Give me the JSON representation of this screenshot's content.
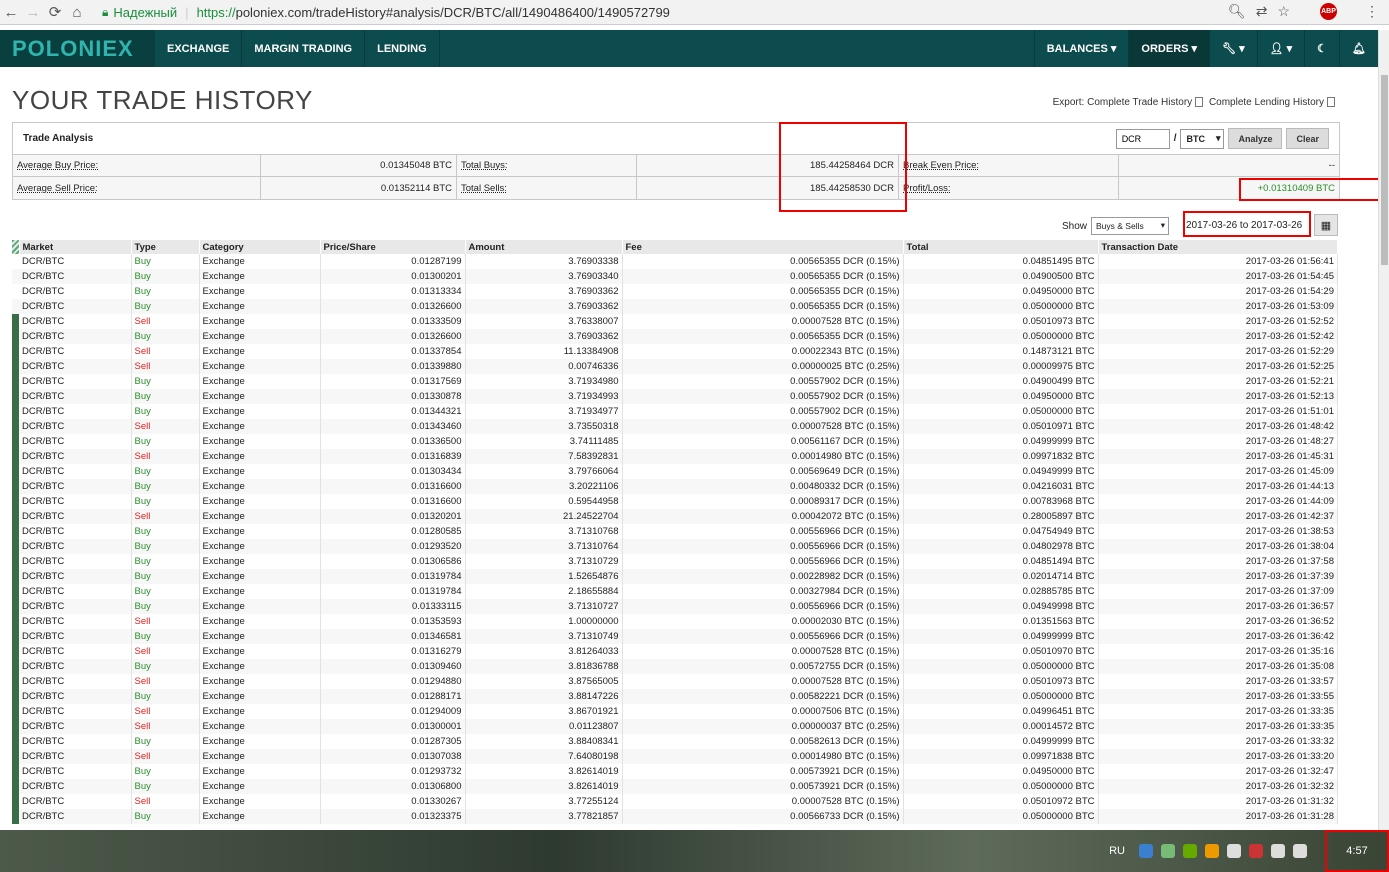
{
  "browser": {
    "secure_label": "Надежный",
    "url_scheme": "https://",
    "url_rest": "poloniex.com/tradeHistory#analysis/DCR/BTC/all/1490486400/1490572799",
    "abp": "ABP"
  },
  "nav": {
    "logo": "POLONIEX",
    "left": [
      "EXCHANGE",
      "MARGIN TRADING",
      "LENDING"
    ],
    "balances": "BALANCES ▾",
    "orders": "ORDERS ▾"
  },
  "page": {
    "title": "YOUR TRADE HISTORY",
    "export_prefix": "Export:",
    "export_trade": "Complete Trade History",
    "export_lending": "Complete Lending History"
  },
  "analysis": {
    "heading": "Trade Analysis",
    "coin_input": "DCR",
    "slash": "/",
    "base_select": "BTC",
    "analyze": "Analyze",
    "clear": "Clear",
    "avg_buy_label": "Average Buy Price:",
    "avg_buy": "0.01345048 BTC",
    "total_buys_label": "Total Buys:",
    "total_buys": "185.44258464 DCR",
    "break_even_label": "Break Even Price:",
    "break_even": "--",
    "avg_sell_label": "Average Sell Price:",
    "avg_sell": "0.01352114 BTC",
    "total_sells_label": "Total Sells:",
    "total_sells": "185.44258530 DCR",
    "pl_label": "Profit/Loss:",
    "pl": "+0.01310409 BTC"
  },
  "filter": {
    "show_label": "Show",
    "show_value": "Buys & Sells",
    "date_range": "2017-03-26 to 2017-03-26"
  },
  "columns": [
    "Market",
    "Type",
    "Category",
    "Price/Share",
    "Amount",
    "Fee",
    "Total",
    "Transaction Date"
  ],
  "rows": [
    [
      "DCR/BTC",
      "Buy",
      "Exchange",
      "0.01287199",
      "3.76903338",
      "0.00565355 DCR (0.15%)",
      "0.04851495 BTC",
      "2017-03-26 01:56:41"
    ],
    [
      "DCR/BTC",
      "Buy",
      "Exchange",
      "0.01300201",
      "3.76903340",
      "0.00565355 DCR (0.15%)",
      "0.04900500 BTC",
      "2017-03-26 01:54:45"
    ],
    [
      "DCR/BTC",
      "Buy",
      "Exchange",
      "0.01313334",
      "3.76903362",
      "0.00565355 DCR (0.15%)",
      "0.04950000 BTC",
      "2017-03-26 01:54:29"
    ],
    [
      "DCR/BTC",
      "Buy",
      "Exchange",
      "0.01326600",
      "3.76903362",
      "0.00565355 DCR (0.15%)",
      "0.05000000 BTC",
      "2017-03-26 01:53:09"
    ],
    [
      "DCR/BTC",
      "Sell",
      "Exchange",
      "0.01333509",
      "3.76338007",
      "0.00007528 BTC (0.15%)",
      "0.05010973 BTC",
      "2017-03-26 01:52:52"
    ],
    [
      "DCR/BTC",
      "Buy",
      "Exchange",
      "0.01326600",
      "3.76903362",
      "0.00565355 DCR (0.15%)",
      "0.05000000 BTC",
      "2017-03-26 01:52:42"
    ],
    [
      "DCR/BTC",
      "Sell",
      "Exchange",
      "0.01337854",
      "11.13384908",
      "0.00022343 BTC (0.15%)",
      "0.14873121 BTC",
      "2017-03-26 01:52:29"
    ],
    [
      "DCR/BTC",
      "Sell",
      "Exchange",
      "0.01339880",
      "0.00746336",
      "0.00000025 BTC (0.25%)",
      "0.00009975 BTC",
      "2017-03-26 01:52:25"
    ],
    [
      "DCR/BTC",
      "Buy",
      "Exchange",
      "0.01317569",
      "3.71934980",
      "0.00557902 DCR (0.15%)",
      "0.04900499 BTC",
      "2017-03-26 01:52:21"
    ],
    [
      "DCR/BTC",
      "Buy",
      "Exchange",
      "0.01330878",
      "3.71934993",
      "0.00557902 DCR (0.15%)",
      "0.04950000 BTC",
      "2017-03-26 01:52:13"
    ],
    [
      "DCR/BTC",
      "Buy",
      "Exchange",
      "0.01344321",
      "3.71934977",
      "0.00557902 DCR (0.15%)",
      "0.05000000 BTC",
      "2017-03-26 01:51:01"
    ],
    [
      "DCR/BTC",
      "Sell",
      "Exchange",
      "0.01343460",
      "3.73550318",
      "0.00007528 BTC (0.15%)",
      "0.05010971 BTC",
      "2017-03-26 01:48:42"
    ],
    [
      "DCR/BTC",
      "Buy",
      "Exchange",
      "0.01336500",
      "3.74111485",
      "0.00561167 DCR (0.15%)",
      "0.04999999 BTC",
      "2017-03-26 01:48:27"
    ],
    [
      "DCR/BTC",
      "Sell",
      "Exchange",
      "0.01316839",
      "7.58392831",
      "0.00014980 BTC (0.15%)",
      "0.09971832 BTC",
      "2017-03-26 01:45:31"
    ],
    [
      "DCR/BTC",
      "Buy",
      "Exchange",
      "0.01303434",
      "3.79766064",
      "0.00569649 DCR (0.15%)",
      "0.04949999 BTC",
      "2017-03-26 01:45:09"
    ],
    [
      "DCR/BTC",
      "Buy",
      "Exchange",
      "0.01316600",
      "3.20221106",
      "0.00480332 DCR (0.15%)",
      "0.04216031 BTC",
      "2017-03-26 01:44:13"
    ],
    [
      "DCR/BTC",
      "Buy",
      "Exchange",
      "0.01316600",
      "0.59544958",
      "0.00089317 DCR (0.15%)",
      "0.00783968 BTC",
      "2017-03-26 01:44:09"
    ],
    [
      "DCR/BTC",
      "Sell",
      "Exchange",
      "0.01320201",
      "21.24522704",
      "0.00042072 BTC (0.15%)",
      "0.28005897 BTC",
      "2017-03-26 01:42:37"
    ],
    [
      "DCR/BTC",
      "Buy",
      "Exchange",
      "0.01280585",
      "3.71310768",
      "0.00556966 DCR (0.15%)",
      "0.04754949 BTC",
      "2017-03-26 01:38:53"
    ],
    [
      "DCR/BTC",
      "Buy",
      "Exchange",
      "0.01293520",
      "3.71310764",
      "0.00556966 DCR (0.15%)",
      "0.04802978 BTC",
      "2017-03-26 01:38:04"
    ],
    [
      "DCR/BTC",
      "Buy",
      "Exchange",
      "0.01306586",
      "3.71310729",
      "0.00556966 DCR (0.15%)",
      "0.04851494 BTC",
      "2017-03-26 01:37:58"
    ],
    [
      "DCR/BTC",
      "Buy",
      "Exchange",
      "0.01319784",
      "1.52654876",
      "0.00228982 DCR (0.15%)",
      "0.02014714 BTC",
      "2017-03-26 01:37:39"
    ],
    [
      "DCR/BTC",
      "Buy",
      "Exchange",
      "0.01319784",
      "2.18655884",
      "0.00327984 DCR (0.15%)",
      "0.02885785 BTC",
      "2017-03-26 01:37:09"
    ],
    [
      "DCR/BTC",
      "Buy",
      "Exchange",
      "0.01333115",
      "3.71310727",
      "0.00556966 DCR (0.15%)",
      "0.04949998 BTC",
      "2017-03-26 01:36:57"
    ],
    [
      "DCR/BTC",
      "Sell",
      "Exchange",
      "0.01353593",
      "1.00000000",
      "0.00002030 BTC (0.15%)",
      "0.01351563 BTC",
      "2017-03-26 01:36:52"
    ],
    [
      "DCR/BTC",
      "Buy",
      "Exchange",
      "0.01346581",
      "3.71310749",
      "0.00556966 DCR (0.15%)",
      "0.04999999 BTC",
      "2017-03-26 01:36:42"
    ],
    [
      "DCR/BTC",
      "Sell",
      "Exchange",
      "0.01316279",
      "3.81264033",
      "0.00007528 BTC (0.15%)",
      "0.05010970 BTC",
      "2017-03-26 01:35:16"
    ],
    [
      "DCR/BTC",
      "Buy",
      "Exchange",
      "0.01309460",
      "3.81836788",
      "0.00572755 DCR (0.15%)",
      "0.05000000 BTC",
      "2017-03-26 01:35:08"
    ],
    [
      "DCR/BTC",
      "Sell",
      "Exchange",
      "0.01294880",
      "3.87565005",
      "0.00007528 BTC (0.15%)",
      "0.05010973 BTC",
      "2017-03-26 01:33:57"
    ],
    [
      "DCR/BTC",
      "Buy",
      "Exchange",
      "0.01288171",
      "3.88147226",
      "0.00582221 DCR (0.15%)",
      "0.05000000 BTC",
      "2017-03-26 01:33:55"
    ],
    [
      "DCR/BTC",
      "Sell",
      "Exchange",
      "0.01294009",
      "3.86701921",
      "0.00007506 BTC (0.15%)",
      "0.04996451 BTC",
      "2017-03-26 01:33:35"
    ],
    [
      "DCR/BTC",
      "Sell",
      "Exchange",
      "0.01300001",
      "0.01123807",
      "0.00000037 BTC (0.25%)",
      "0.00014572 BTC",
      "2017-03-26 01:33:35"
    ],
    [
      "DCR/BTC",
      "Buy",
      "Exchange",
      "0.01287305",
      "3.88408341",
      "0.00582613 DCR (0.15%)",
      "0.04999999 BTC",
      "2017-03-26 01:33:32"
    ],
    [
      "DCR/BTC",
      "Sell",
      "Exchange",
      "0.01307038",
      "7.64080198",
      "0.00014980 BTC (0.15%)",
      "0.09971838 BTC",
      "2017-03-26 01:33:20"
    ],
    [
      "DCR/BTC",
      "Buy",
      "Exchange",
      "0.01293732",
      "3.82614019",
      "0.00573921 DCR (0.15%)",
      "0.04950000 BTC",
      "2017-03-26 01:32:47"
    ],
    [
      "DCR/BTC",
      "Buy",
      "Exchange",
      "0.01306800",
      "3.82614019",
      "0.00573921 DCR (0.15%)",
      "0.05000000 BTC",
      "2017-03-26 01:32:32"
    ],
    [
      "DCR/BTC",
      "Sell",
      "Exchange",
      "0.01330267",
      "3.77255124",
      "0.00007528 BTC (0.15%)",
      "0.05010972 BTC",
      "2017-03-26 01:31:32"
    ],
    [
      "DCR/BTC",
      "Buy",
      "Exchange",
      "0.01323375",
      "3.77821857",
      "0.00566733 DCR (0.15%)",
      "0.05000000 BTC",
      "2017-03-26 01:31:28"
    ]
  ],
  "taskbar": {
    "lang": "RU",
    "clock": "4:57"
  },
  "colors": {
    "nav_bg": "#0d4c4e",
    "buy": "#2a8f2a",
    "sell": "#dd2222",
    "highlight": "#e00000"
  }
}
